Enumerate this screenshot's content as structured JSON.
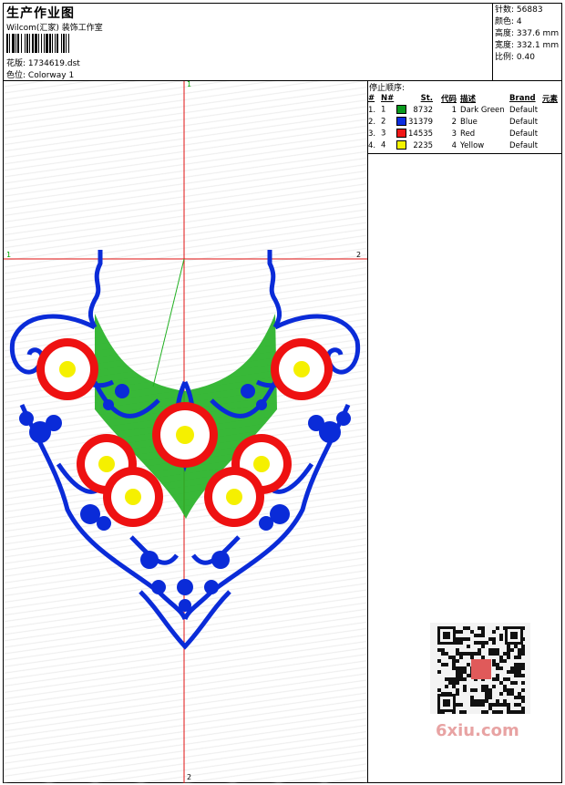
{
  "header": {
    "title": "生产作业图",
    "company": "Wilcom(汇家) 装饰工作室",
    "pattern_label": "花版:",
    "pattern_value": "1734619.dst",
    "colorway_label": "色位:",
    "colorway_value": "Colorway 1"
  },
  "stats": {
    "stitches_label": "针数:",
    "stitches_value": "56883",
    "colors_label": "颜色:",
    "colors_value": "4",
    "height_label": "高度:",
    "height_value": "337.6 mm",
    "width_label": "宽度:",
    "width_value": "332.1 mm",
    "scale_label": "比例:",
    "scale_value": "0.40"
  },
  "stop_sequence": {
    "title": "停止顺序:",
    "headers": [
      "#",
      "N#",
      "St.",
      "代码",
      "描述",
      "Brand",
      "元素"
    ],
    "rows": [
      {
        "idx": "1.",
        "n": "1",
        "color": "#0a9a1e",
        "st": "8732",
        "code": "1",
        "desc": "Dark Green",
        "brand": "Default"
      },
      {
        "idx": "2.",
        "n": "2",
        "color": "#0b2ee0",
        "st": "31379",
        "code": "2",
        "desc": "Blue",
        "brand": "Default"
      },
      {
        "idx": "3.",
        "n": "3",
        "color": "#f01818",
        "st": "14535",
        "code": "3",
        "desc": "Red",
        "brand": "Default"
      },
      {
        "idx": "4.",
        "n": "4",
        "color": "#f4f400",
        "st": "2235",
        "code": "4",
        "desc": "Yellow",
        "brand": "Default"
      }
    ]
  },
  "axes": {
    "top": "1",
    "left": "1",
    "right": "2",
    "bottom": "2"
  },
  "watermark": "6xiu.com",
  "colors": {
    "green": "#22b022",
    "blue": "#0a2bd8",
    "red": "#ee1111",
    "yellow": "#f5f000",
    "axis": "#e01010"
  }
}
